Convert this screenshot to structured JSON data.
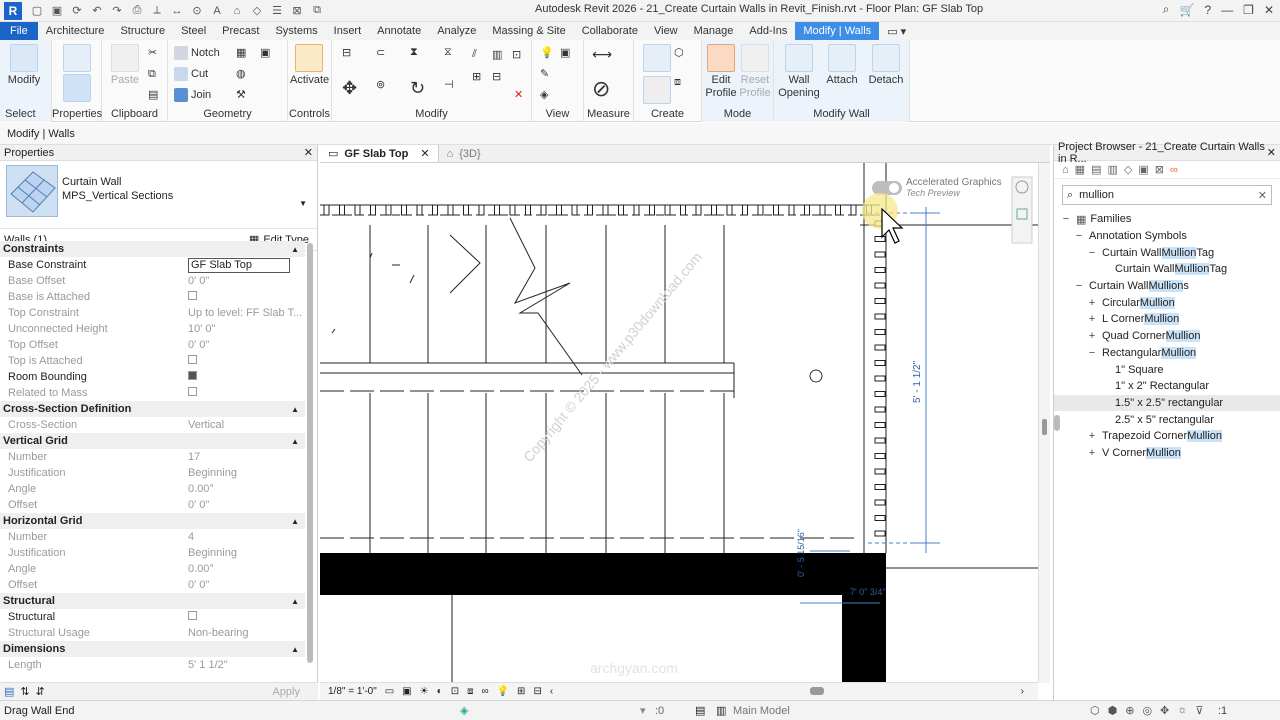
{
  "titlebar": {
    "title": "Autodesk Revit 2026 - 21_Create Curtain Walls in Revit_Finish.rvt - Floor Plan: GF Slab Top",
    "logo_letter": "R"
  },
  "ribbon_tabs": [
    "File",
    "Architecture",
    "Structure",
    "Steel",
    "Precast",
    "Systems",
    "Insert",
    "Annotate",
    "Analyze",
    "Massing & Site",
    "Collaborate",
    "View",
    "Manage",
    "Add-Ins",
    "Modify | Walls"
  ],
  "ribbon": {
    "select": {
      "modify": "Modify",
      "label": "Select"
    },
    "properties": {
      "label": "Properties"
    },
    "clipboard": {
      "paste": "Paste",
      "label": "Clipboard"
    },
    "geometry": {
      "notch": "Notch",
      "cut": "Cut",
      "join": "Join",
      "label": "Geometry"
    },
    "controls": {
      "activate": "Activate",
      "label": "Controls"
    },
    "modify": {
      "label": "Modify"
    },
    "view": {
      "label": "View"
    },
    "measure": {
      "label": "Measure"
    },
    "create": {
      "label": "Create"
    },
    "mode": {
      "edit_profile_1": "Edit",
      "edit_profile_2": "Profile",
      "reset_profile_1": "Reset",
      "reset_profile_2": "Profile",
      "label": "Mode"
    },
    "modify_wall": {
      "wall_opening_1": "Wall",
      "wall_opening_2": "Opening",
      "attach": "Attach",
      "detach": "Detach",
      "label": "Modify Wall"
    }
  },
  "context_bar": "Modify | Walls",
  "properties": {
    "title": "Properties",
    "type_family": "Curtain Wall",
    "type_name": "MPS_Vertical Sections",
    "instance_filter": "Walls (1)",
    "edit_type": "Edit Type",
    "apply": "Apply",
    "rows": [
      {
        "kind": "cat",
        "k": "Constraints"
      },
      {
        "kind": "field",
        "k": "Base Constraint",
        "v": "GF Slab Top"
      },
      {
        "kind": "row",
        "k": "Base Offset",
        "v": "0'  0\""
      },
      {
        "kind": "ro-chk",
        "k": "Base is Attached",
        "checked": false
      },
      {
        "kind": "row",
        "k": "Top Constraint",
        "v": "Up to level: FF Slab T..."
      },
      {
        "kind": "ro",
        "k": "Unconnected Height",
        "v": "10'  0\""
      },
      {
        "kind": "row",
        "k": "Top Offset",
        "v": "0'  0\""
      },
      {
        "kind": "ro-chk",
        "k": "Top is Attached",
        "checked": false
      },
      {
        "kind": "chk",
        "k": "Room Bounding",
        "checked": true
      },
      {
        "kind": "ro-chk",
        "k": "Related to Mass",
        "checked": false
      },
      {
        "kind": "cat",
        "k": "Cross-Section Definition"
      },
      {
        "kind": "row",
        "k": "Cross-Section",
        "v": "Vertical"
      },
      {
        "kind": "cat",
        "k": "Vertical Grid"
      },
      {
        "kind": "ro",
        "k": "Number",
        "v": "17"
      },
      {
        "kind": "row",
        "k": "Justification",
        "v": "Beginning"
      },
      {
        "kind": "row",
        "k": "Angle",
        "v": "0.00°"
      },
      {
        "kind": "row",
        "k": "Offset",
        "v": "0'  0\""
      },
      {
        "kind": "cat",
        "k": "Horizontal Grid"
      },
      {
        "kind": "ro",
        "k": "Number",
        "v": "4"
      },
      {
        "kind": "ro",
        "k": "Justification",
        "v": "Beginning"
      },
      {
        "kind": "row",
        "k": "Angle",
        "v": "0.00°"
      },
      {
        "kind": "row",
        "k": "Offset",
        "v": "0'  0\""
      },
      {
        "kind": "cat",
        "k": "Structural"
      },
      {
        "kind": "chk",
        "k": "Structural",
        "checked": false
      },
      {
        "kind": "ro",
        "k": "Structural Usage",
        "v": "Non-bearing"
      },
      {
        "kind": "cat",
        "k": "Dimensions"
      },
      {
        "kind": "ro",
        "k": "Length",
        "v": "5'  1 1/2\""
      }
    ]
  },
  "view_tabs": [
    {
      "label": "GF Slab Top",
      "active": true
    },
    {
      "label": "{3D}",
      "active": false
    }
  ],
  "canvas": {
    "accel_title": "Accelerated Graphics",
    "accel_sub": "Tech Preview",
    "dim_vertical": "5' - 1 1/2\"",
    "dim_small": "0' - 5 15/16\"",
    "dim_corner": "7' 0\"  3/4\"",
    "watermark": "Copyright © 2025 - www.p30download.com",
    "watermark2": "archgyan.com"
  },
  "view_control": {
    "scale": "1/8\" = 1'-0\""
  },
  "project_browser": {
    "title": "Project Browser - 21_Create Curtain Walls in R...",
    "search": "mullion",
    "items": [
      {
        "level": 0,
        "toggle": "−",
        "pre": "Families",
        "hl": "",
        "post": ""
      },
      {
        "level": 1,
        "toggle": "−",
        "pre": "Annotation Symbols",
        "hl": "",
        "post": ""
      },
      {
        "level": 2,
        "toggle": "−",
        "pre": "Curtain Wall ",
        "hl": "Mullion",
        "post": " Tag"
      },
      {
        "level": 3,
        "toggle": "",
        "pre": "Curtain Wall ",
        "hl": "Mullion",
        "post": " Tag"
      },
      {
        "level": 1,
        "toggle": "−",
        "pre": "Curtain Wall ",
        "hl": "Mullion",
        "post": "s"
      },
      {
        "level": 2,
        "toggle": "+",
        "pre": "Circular ",
        "hl": "Mullion",
        "post": ""
      },
      {
        "level": 2,
        "toggle": "+",
        "pre": "L Corner ",
        "hl": "Mullion",
        "post": ""
      },
      {
        "level": 2,
        "toggle": "+",
        "pre": "Quad Corner ",
        "hl": "Mullion",
        "post": ""
      },
      {
        "level": 2,
        "toggle": "−",
        "pre": "Rectangular ",
        "hl": "Mullion",
        "post": ""
      },
      {
        "level": 3,
        "toggle": "",
        "pre": "1\" Square",
        "hl": "",
        "post": ""
      },
      {
        "level": 3,
        "toggle": "",
        "pre": "1\" x 2\" Rectangular",
        "hl": "",
        "post": ""
      },
      {
        "level": 3,
        "toggle": "",
        "pre": "1.5\" x 2.5\" rectangular",
        "hl": "",
        "post": "",
        "selected": true
      },
      {
        "level": 3,
        "toggle": "",
        "pre": "2.5\" x 5\" rectangular",
        "hl": "",
        "post": ""
      },
      {
        "level": 2,
        "toggle": "+",
        "pre": "Trapezoid Corner ",
        "hl": "Mullion",
        "post": ""
      },
      {
        "level": 2,
        "toggle": "+",
        "pre": "V Corner ",
        "hl": "Mullion",
        "post": ""
      }
    ]
  },
  "status": {
    "message": "Drag Wall End",
    "coord": ":0",
    "model": "Main Model",
    "filter": ":1"
  },
  "colors": {
    "accent": "#1b64c8",
    "active_tab": "#3e8ee8",
    "highlight": "#c9e2f7"
  }
}
